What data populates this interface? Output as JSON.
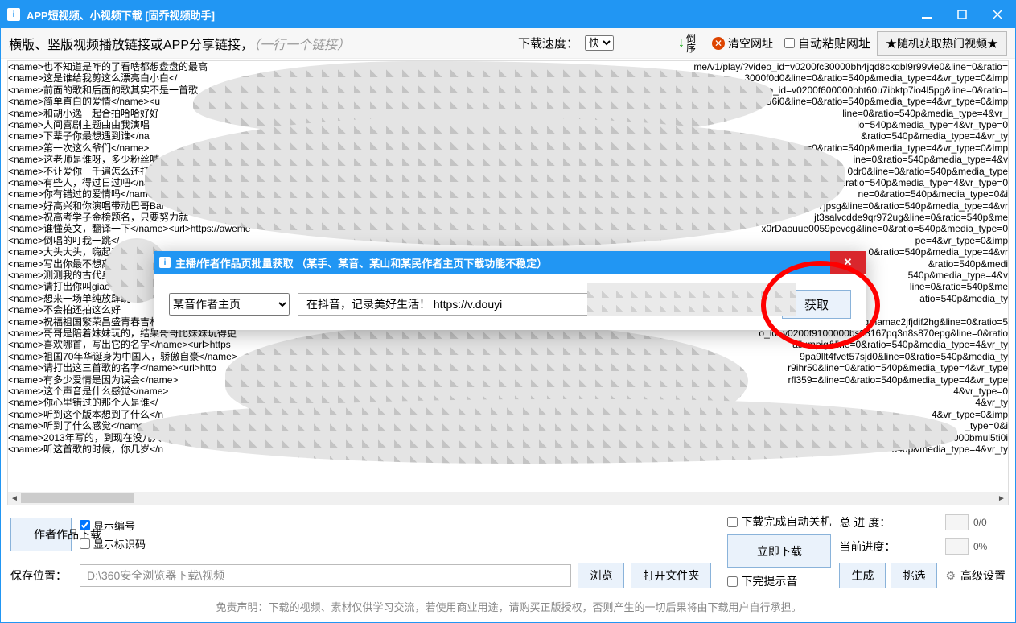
{
  "title": "APP短视频、小视频下载 [固乔视频助手]",
  "toolbar": {
    "hint_dark": "横版、竖版视频播放链接或APP分享链接，",
    "hint_light": "（一行一个链接）",
    "speed_label": "下载速度：",
    "speed_value": "快",
    "speed_options": [
      "快"
    ],
    "sort_top": "倒",
    "sort_bottom": "序",
    "clear_label": "清空网址",
    "auto_paste_label": "自动粘贴网址",
    "random_hot": "★随机获取热门视频★"
  },
  "lines": {
    "left": [
      "<name>也不知道是咋的了看啥都想盘盘的最高",
      "<name>这是谁给我剪这么漂亮白小白</",
      "<name>前面的歌和后面的歌其实不是一首歌",
      "<name>简单直白的爱情</name><u",
      "<name>和胡小逸一起合拍哈哈好好",
      "<name>人间喜剧主题曲由我演唱",
      "<name>下辈子你最想遇到谁</na",
      "<name>第一次这么爷们</name>",
      "<name>这老师是谁呀，多少粉丝喊",
      "<name>不让爱你一千遍怎么还打赌",
      "<name>有些人，得过日过吧</na",
      "<name>你有错过的爱情吗</name",
      "<name>好高兴和你演唱带动巴哥Bar",
      "<name>祝高考学子金榜题名，只要努力就",
      "<name>谁懂英文，翻译一下</name><url>https://aweme",
      "<name>倒唱的叮我一跳</",
      "<name>大头大头，嗨起来嗨",
      "<name>写出你最不想离开的",
      "<name>测测我的古代身份!!",
      "<name>请打出你叫giao什",
      "<name>想来一场单纯放肆跳",
      "<name>不会拍还拍这么好",
      "<name>祝福祖国繁荣昌盛青春吉林我们一起开创中国!!",
      "<name>哥哥是陪着妹妹玩的，结果哥哥比妹妹玩得更",
      "<name>喜欢哪首，写出它的名字</name><url>https",
      "<name>祖国70年华诞身为中国人，骄傲自豪</name>",
      "<name>请打出这三首歌的名字</name><url>http",
      "<name>有多少爱情是因为误会</name>",
      "<name>这个声音是什么感觉</name>",
      "<name>你心里错过的那个人是谁</",
      "<name>听到这个版本想到了什么</n",
      "<name>听到了什么感觉</name><url",
      "<name>2013年写的，到现在没几人听过它",
      "<name>听这首歌的时候，你几岁</n"
    ],
    "right": [
      "me/v1/play/?video_id=v0200fc30000bh4jqd8ckqbl9r99vie0&line=0&ratio=",
      "3000f0d0&line=0&ratio=540p&media_type=4&vr_type=0&imp",
      "1/play/?video_id=v0200f600000bht60u7ibktp7io4l5pg&line=0&ratio=",
      "47ovo91hievd6i0&line=0&ratio=540p&media_type=4&vr_type=0&imp",
      "line=0&ratio=540p&media_type=4&vr_",
      "io=540p&media_type=4&vr_type=0",
      "&ratio=540p&media_type=4&vr_ty",
      "line=0&ratio=540p&media_type=4&vr_type=0&imp",
      "ine=0&ratio=540p&media_type=4&v",
      "0dr0&line=0&ratio=540p&media_type",
      "line=0&ratio=540p&media_type=4&vr_type=0",
      "ne=0&ratio=540p&media_type=0&i",
      "7jpsg&line=0&ratio=540p&media_type=4&vr",
      "jt3salvcdde9qr972ug&line=0&ratio=540p&me",
      "x0rDaouue0059pevcg&line=0&ratio=540p&media_type=0",
      "pe=4&vr_type=0&imp",
      "0&ratio=540p&media_type=4&vr",
      "&ratio=540p&medi",
      "540p&media_type=4&v",
      "line=0&ratio=540p&me",
      "atio=540p&media_ty",
      "",
      "=v0200fc9000bm4uqmamac2jfjdif2hg&line=0&ratio=5",
      "o_id=v0200f9100000bs08167pq3n8s870epg&line=0&ratio",
      "ailumpig&line=0&ratio=540p&media_type=4&vr_ty",
      "9pa9llt4fvet57sjd0&line=0&ratio=540p&media_ty",
      "r9ihr50&line=0&ratio=540p&media_type=4&vr_type",
      "rfl359=&line=0&ratio=540p&media_type=4&vr_type",
      "4&vr_type=0",
      "4&vr_ty",
      "4&vr_type=0&imp",
      "_type=0&i",
      "30000bmul5ti0i",
      "ratio=540p&media_type=4&vr_ty"
    ]
  },
  "progress": {
    "total_label": "总 进 度：",
    "total_text": "0/0",
    "current_label": "当前进度：",
    "current_text": "0%"
  },
  "path": {
    "label": "保存位置：",
    "value": "D:\\360安全浏览器下载\\视频",
    "browse": "浏览",
    "open_folder": "打开文件夹"
  },
  "buttons": {
    "author_download": "作者作品下载",
    "generate": "生成",
    "select": "挑选",
    "advanced": "高级设置",
    "download_now": "立即下载"
  },
  "checks": {
    "show_index": "显示编号",
    "show_tag": "显示标识码",
    "auto_shutdown": "下载完成自动关机",
    "done_sound": "下完提示音"
  },
  "disclaimer": "免责声明：下载的视频、素材仅供学习交流，若使用商业用途，请购买正版授权，否则产生的一切后果将由下载用户自行承担。",
  "dialog": {
    "title": "主播/作者作品页批量获取 （某手、某音、某山和某民作者主页下载功能不稳定）",
    "select_value": "某音作者主页",
    "input_value": "在抖音，记录美好生活！ https://v.douyi",
    "fetch": "获取"
  }
}
